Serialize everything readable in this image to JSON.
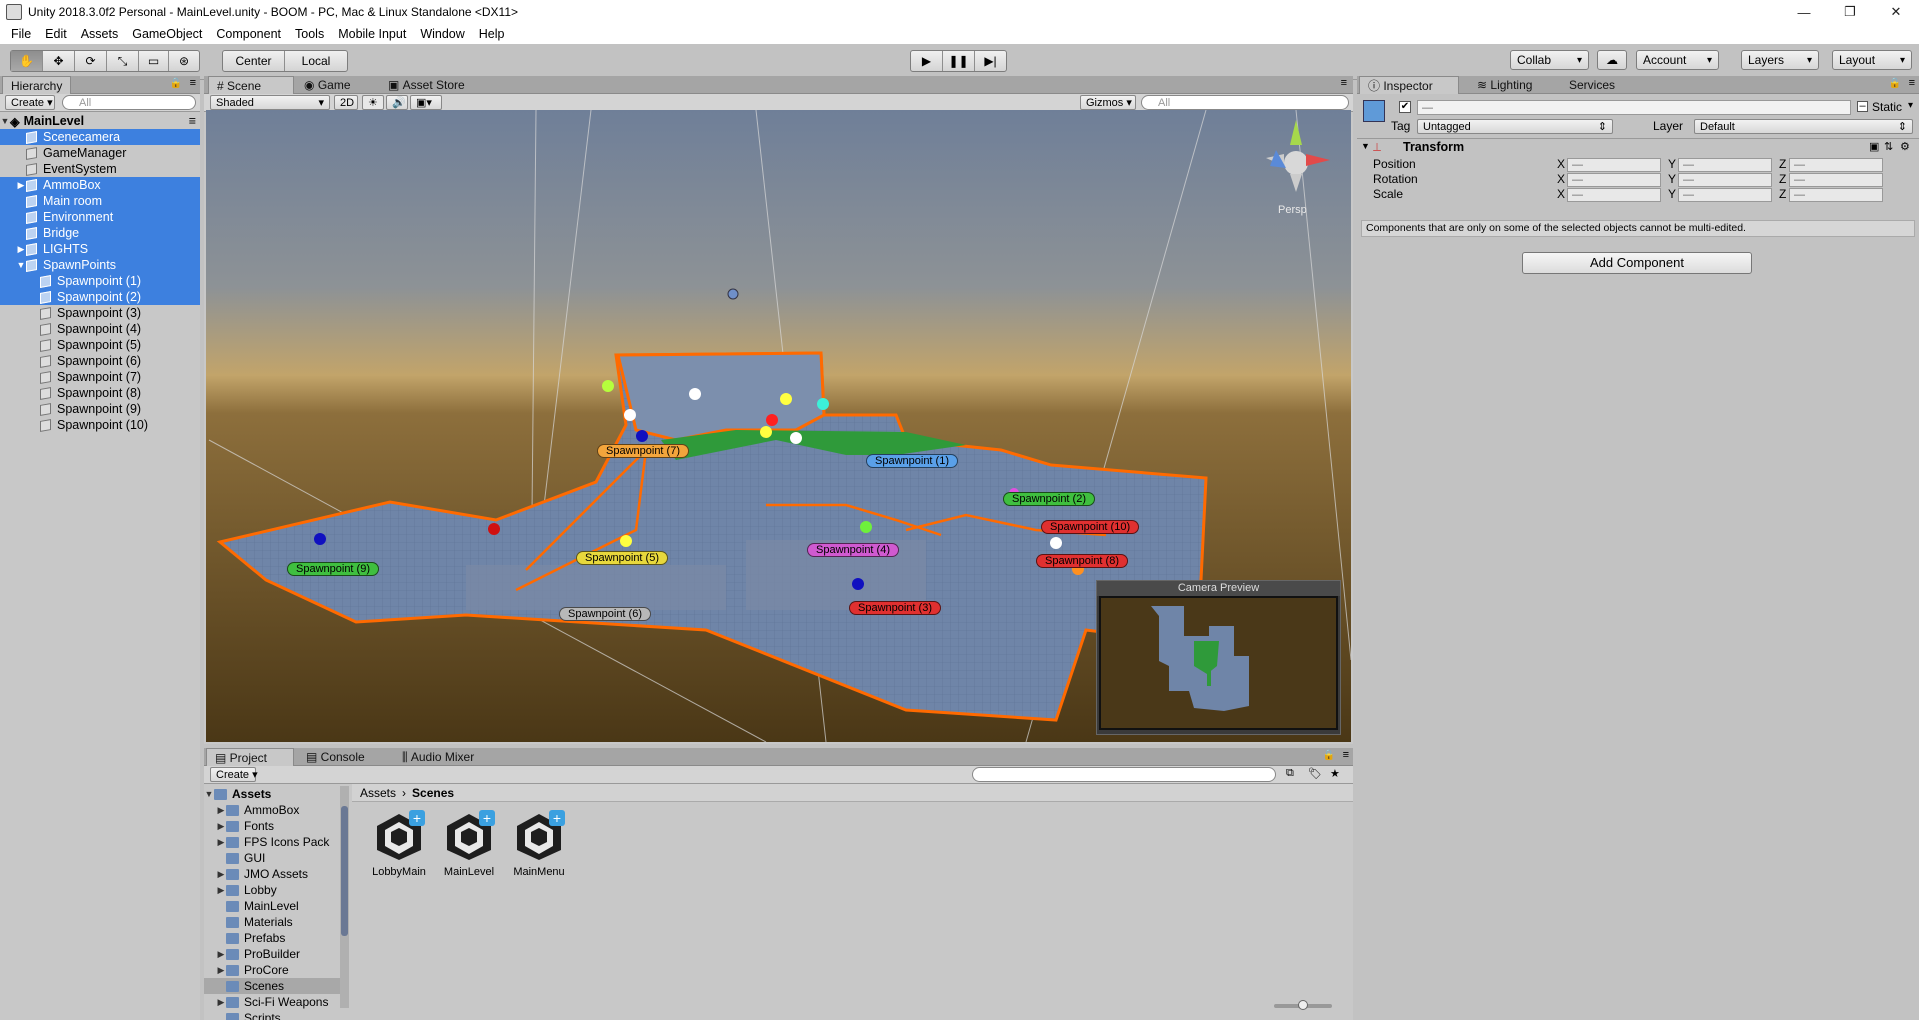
{
  "window": {
    "title": "Unity 2018.3.0f2 Personal - MainLevel.unity - BOOM - PC, Mac & Linux Standalone <DX11>",
    "minimize": "—",
    "maximize": "❐",
    "close": "✕"
  },
  "menu": [
    "File",
    "Edit",
    "Assets",
    "GameObject",
    "Component",
    "Tools",
    "Mobile Input",
    "Window",
    "Help"
  ],
  "toolbar": {
    "pivot": "Center",
    "space": "Local",
    "collab": "Collab",
    "account": "Account",
    "layers": "Layers",
    "layout": "Layout"
  },
  "hierarchy": {
    "tab": "Hierarchy",
    "create": "Create",
    "search_placeholder": "All",
    "scene": "MainLevel",
    "items": [
      {
        "label": "Scenecamera",
        "sel": true,
        "indent": 1,
        "arrow": ""
      },
      {
        "label": "GameManager",
        "sel": false,
        "indent": 1,
        "arrow": ""
      },
      {
        "label": "EventSystem",
        "sel": false,
        "indent": 1,
        "arrow": ""
      },
      {
        "label": "AmmoBox",
        "sel": true,
        "indent": 1,
        "arrow": "▶"
      },
      {
        "label": "Main room",
        "sel": true,
        "indent": 1,
        "arrow": ""
      },
      {
        "label": "Environment",
        "sel": true,
        "indent": 1,
        "arrow": ""
      },
      {
        "label": "Bridge",
        "sel": true,
        "indent": 1,
        "arrow": ""
      },
      {
        "label": "LIGHTS",
        "sel": true,
        "indent": 1,
        "arrow": "▶"
      },
      {
        "label": "SpawnPoints",
        "sel": true,
        "indent": 1,
        "arrow": "▼"
      },
      {
        "label": "Spawnpoint (1)",
        "sel": true,
        "indent": 2,
        "arrow": ""
      },
      {
        "label": "Spawnpoint (2)",
        "sel": true,
        "indent": 2,
        "arrow": ""
      },
      {
        "label": "Spawnpoint (3)",
        "sel": false,
        "indent": 2,
        "arrow": ""
      },
      {
        "label": "Spawnpoint (4)",
        "sel": false,
        "indent": 2,
        "arrow": ""
      },
      {
        "label": "Spawnpoint (5)",
        "sel": false,
        "indent": 2,
        "arrow": ""
      },
      {
        "label": "Spawnpoint (6)",
        "sel": false,
        "indent": 2,
        "arrow": ""
      },
      {
        "label": "Spawnpoint (7)",
        "sel": false,
        "indent": 2,
        "arrow": ""
      },
      {
        "label": "Spawnpoint (8)",
        "sel": false,
        "indent": 2,
        "arrow": ""
      },
      {
        "label": "Spawnpoint (9)",
        "sel": false,
        "indent": 2,
        "arrow": ""
      },
      {
        "label": "Spawnpoint (10)",
        "sel": false,
        "indent": 2,
        "arrow": ""
      }
    ]
  },
  "scene_view": {
    "tabs": [
      "Scene",
      "Game",
      "Asset Store"
    ],
    "shading": "Shaded",
    "mode_2d": "2D",
    "gizmos": "Gizmos",
    "search_placeholder": "All",
    "persp": "Persp",
    "camera_preview": "Camera Preview",
    "spawn_labels": [
      {
        "text": "Spawnpoint (7)",
        "color": "#f3a53c"
      },
      {
        "text": "Spawnpoint (1)",
        "color": "#5aa0e8"
      },
      {
        "text": "Spawnpoint (2)",
        "color": "#3fbf3f"
      },
      {
        "text": "Spawnpoint (10)",
        "color": "#e03030"
      },
      {
        "text": "Spawnpoint (9)",
        "color": "#3fbf3f"
      },
      {
        "text": "Spawnpoint (5)",
        "color": "#e8d83c"
      },
      {
        "text": "Spawnpoint (4)",
        "color": "#d05ad0"
      },
      {
        "text": "Spawnpoint (8)",
        "color": "#e03030"
      },
      {
        "text": "Spawnpoint (6)",
        "color": "#b8b8b8"
      },
      {
        "text": "Spawnpoint (3)",
        "color": "#e03030"
      }
    ]
  },
  "inspector": {
    "tabs": [
      "Inspector",
      "Lighting",
      "Services"
    ],
    "name_value": "—",
    "static": "Static",
    "tag_label": "Tag",
    "tag_value": "Untagged",
    "layer_label": "Layer",
    "layer_value": "Default",
    "transform": "Transform",
    "rows": [
      "Position",
      "Rotation",
      "Scale"
    ],
    "axes": [
      "X",
      "Y",
      "Z"
    ],
    "field_value": "—",
    "note": "Components that are only on some of the selected objects cannot be multi-edited.",
    "add_component": "Add Component"
  },
  "project": {
    "tabs": [
      "Project",
      "Console",
      "Audio Mixer"
    ],
    "create": "Create",
    "root": "Assets",
    "tree": [
      {
        "label": "AmmoBox",
        "arrow": "▶"
      },
      {
        "label": "Fonts",
        "arrow": "▶"
      },
      {
        "label": "FPS Icons Pack",
        "arrow": "▶"
      },
      {
        "label": "GUI",
        "arrow": ""
      },
      {
        "label": "JMO Assets",
        "arrow": "▶"
      },
      {
        "label": "Lobby",
        "arrow": "▶"
      },
      {
        "label": "MainLevel",
        "arrow": ""
      },
      {
        "label": "Materials",
        "arrow": ""
      },
      {
        "label": "Prefabs",
        "arrow": ""
      },
      {
        "label": "ProBuilder",
        "arrow": "▶"
      },
      {
        "label": "ProCore",
        "arrow": "▶"
      },
      {
        "label": "Scenes",
        "arrow": ""
      },
      {
        "label": "Sci-Fi Weapons",
        "arrow": "▶"
      },
      {
        "label": "Scripts",
        "arrow": ""
      }
    ],
    "breadcrumb": [
      "Assets",
      "Scenes"
    ],
    "assets": [
      "LobbyMain",
      "MainLevel",
      "MainMenu"
    ]
  }
}
